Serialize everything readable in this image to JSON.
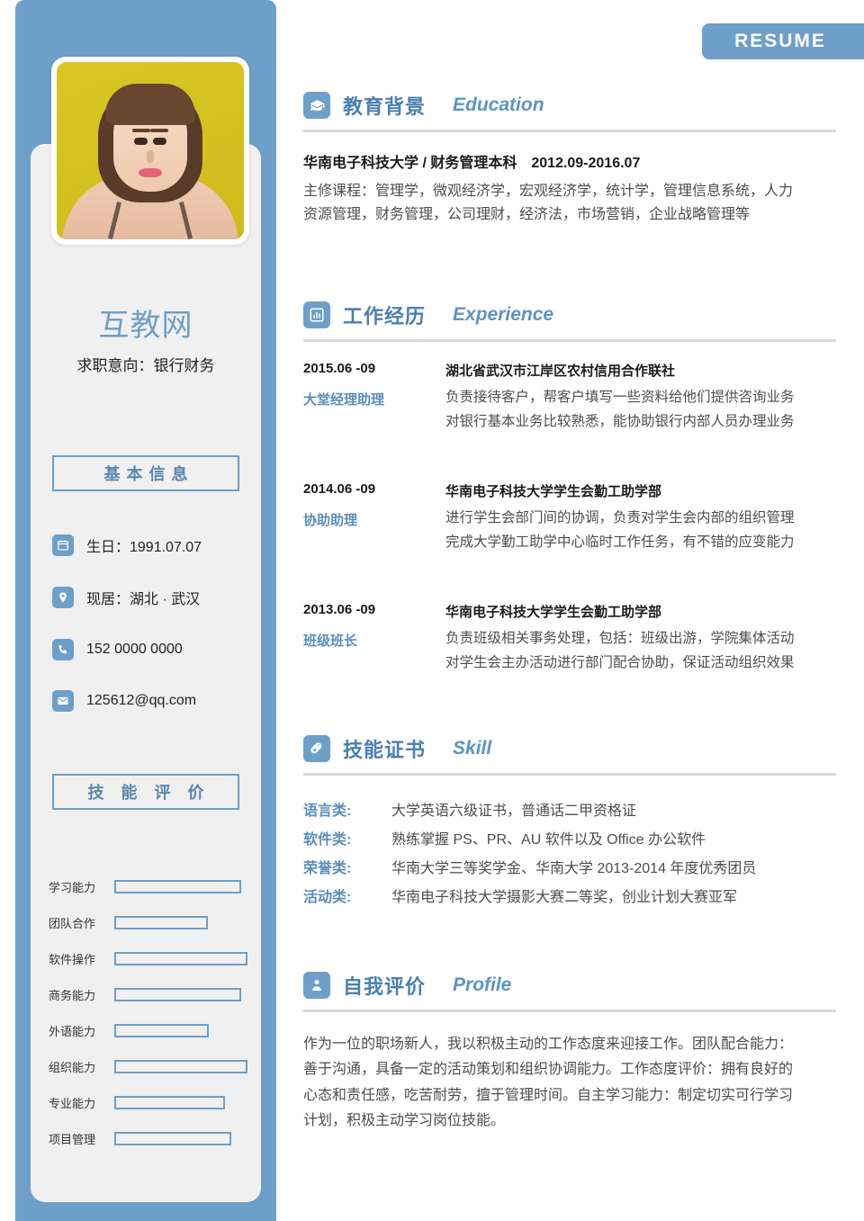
{
  "badge": {
    "label": "RESUME"
  },
  "colors": {
    "accent": "#6e9fc9",
    "heading": "#4a80b0",
    "card": "#f0f0f0",
    "rule": "#d9d9d9"
  },
  "sidebar": {
    "brand": "互教网",
    "objective": "求职意向：银行财务",
    "basic_info_title": "基本信息",
    "contacts": [
      {
        "icon": "calendar-icon",
        "text": "生日：1991.07.07"
      },
      {
        "icon": "location-pin-icon",
        "text": "现居：湖北 · 武汉"
      },
      {
        "icon": "phone-icon",
        "text": "152 0000 0000"
      },
      {
        "icon": "envelope-icon",
        "text": "125612@qq.com"
      }
    ],
    "skill_rating_title": "技 能 评 价",
    "ratings": [
      {
        "label": "学习能力",
        "percent": 95
      },
      {
        "label": "团队合作",
        "percent": 70
      },
      {
        "label": "软件操作",
        "percent": 100
      },
      {
        "label": "商务能力",
        "percent": 95
      },
      {
        "label": "外语能力",
        "percent": 71
      },
      {
        "label": "组织能力",
        "percent": 100
      },
      {
        "label": "专业能力",
        "percent": 83
      },
      {
        "label": "项目管理",
        "percent": 88
      }
    ]
  },
  "education": {
    "icon": "graduation-cap-icon",
    "title_cn": "教育背景",
    "title_en": "Education",
    "school": "华南电子科技大学 / 财务管理本科",
    "period": "2012.09-2016.07",
    "courses_line1": "主修课程：管理学，微观经济学，宏观经济学，统计学，管理信息系统，人力",
    "courses_line2": "资源管理，财务管理，公司理财，经济法，市场营销，企业战略管理等"
  },
  "experience": {
    "icon": "bar-chart-icon",
    "title_cn": "工作经历",
    "title_en": "Experience",
    "items": [
      {
        "date": "2015.06 -09",
        "role": "大堂经理助理",
        "org": "湖北省武汉市江岸区农村信用合作联社",
        "line1": "负责接待客户，帮客户填写一些资料给他们提供咨询业务",
        "line2": "对银行基本业务比较熟悉，能协助银行内部人员办理业务"
      },
      {
        "date": "2014.06 -09",
        "role": "协助助理",
        "org": "华南电子科技大学学生会勤工助学部",
        "line1": "进行学生会部门间的协调，负责对学生会内部的组织管理",
        "line2": "完成大学勤工助学中心临时工作任务，有不错的应变能力"
      },
      {
        "date": "2013.06 -09",
        "role": "班级班长",
        "org": "华南电子科技大学学生会勤工助学部",
        "line1": "负责班级相关事务处理，包括：班级出游，学院集体活动",
        "line2": "对学生会主办活动进行部门配合协助，保证活动组织效果"
      }
    ]
  },
  "skill": {
    "icon": "mouse-icon",
    "title_cn": "技能证书",
    "title_en": "Skill",
    "rows": [
      {
        "key": "语言类:",
        "value": "大学英语六级证书，普通话二甲资格证"
      },
      {
        "key": "软件类:",
        "value": "熟练掌握 PS、PR、AU 软件以及 Office 办公软件"
      },
      {
        "key": "荣誉类:",
        "value": "华南大学三等奖学金、华南大学 2013-2014 年度优秀团员"
      },
      {
        "key": "活动类:",
        "value": "华南电子科技大学摄影大赛二等奖，创业计划大赛亚军"
      }
    ]
  },
  "profile": {
    "icon": "person-badge-icon",
    "title_cn": "自我评价",
    "title_en": "Profile",
    "line1": "作为一位的职场新人，我以积极主动的工作态度来迎接工作。团队配合能力：",
    "line2": "善于沟通，具备一定的活动策划和组织协调能力。工作态度评价：拥有良好的",
    "line3": "心态和责任感，吃苦耐劳，擅于管理时间。自主学习能力：制定切实可行学习",
    "line4": "计划，积极主动学习岗位技能。"
  }
}
